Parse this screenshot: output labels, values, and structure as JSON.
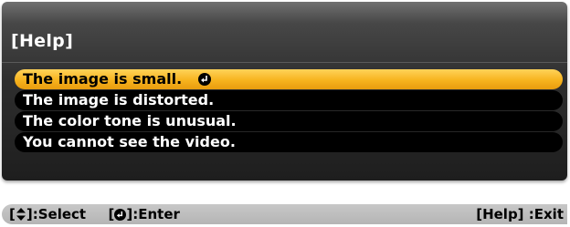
{
  "dialog": {
    "title": "[Help]",
    "items": [
      {
        "label": "The image is small.",
        "selected": true
      },
      {
        "label": "The image is distorted.",
        "selected": false
      },
      {
        "label": "The color tone is unusual.",
        "selected": false
      },
      {
        "label": "You cannot see the video.",
        "selected": false
      }
    ],
    "selection_color": "#f7b31e"
  },
  "statusbar": {
    "select_open": "[",
    "select_close": "]:Select",
    "enter_open": "[",
    "enter_close": "]:Enter",
    "exit_hint": "[Help] :Exit"
  },
  "icons": {
    "enter": "enter-icon",
    "updown": "up-down-arrow-icon"
  }
}
